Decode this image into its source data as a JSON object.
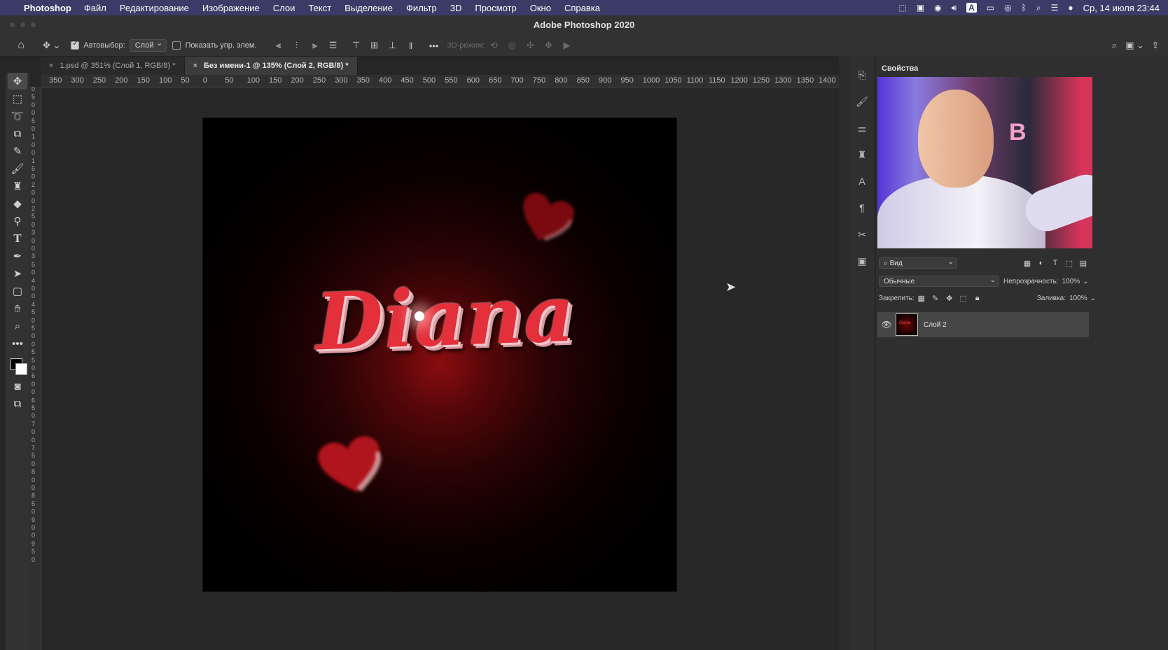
{
  "menubar": {
    "app_name": "Photoshop",
    "items": [
      "Файл",
      "Редактирование",
      "Изображение",
      "Слои",
      "Текст",
      "Выделение",
      "Фильтр",
      "3D",
      "Просмотр",
      "Окно",
      "Справка"
    ],
    "clock": "Ср, 14 июля  23:44",
    "status_icons": [
      "screenshot-icon",
      "record-icon",
      "wifi-icon",
      "volume-icon",
      "keyboard-layout-icon",
      "battery-icon",
      "user-icon",
      "bluetooth-icon",
      "spotlight-icon",
      "control-center-icon",
      "siri-icon"
    ],
    "input_source": "A"
  },
  "window": {
    "title": "Adobe Photoshop 2020"
  },
  "options_bar": {
    "autoselect_label": "Автовыбор:",
    "autoselect_value": "Слой",
    "show_transform_label": "Показать упр. элем.",
    "mode_3d_label": "3D-режим:"
  },
  "tabs": [
    {
      "label": "1.psd @ 351% (Слой 1, RGB/8) *",
      "active": false
    },
    {
      "label": "Без имени-1 @ 135% (Слой 2, RGB/8) *",
      "active": true
    }
  ],
  "ruler_h": [
    "350",
    "300",
    "250",
    "200",
    "150",
    "100",
    "50",
    "0",
    "50",
    "100",
    "150",
    "200",
    "250",
    "300",
    "350",
    "400",
    "450",
    "500",
    "550",
    "600",
    "650",
    "700",
    "750",
    "800",
    "850",
    "900",
    "950",
    "1000",
    "1050",
    "1100",
    "1150",
    "1200",
    "1250",
    "1300",
    "1350",
    "1400"
  ],
  "ruler_v": [
    "0",
    "5",
    "0",
    "0",
    "5",
    "0",
    "1",
    "0",
    "0",
    "1",
    "5",
    "0",
    "2",
    "0",
    "0",
    "2",
    "5",
    "0",
    "3",
    "0",
    "0",
    "3",
    "5",
    "0",
    "4",
    "0",
    "0",
    "4",
    "5",
    "0",
    "5",
    "0",
    "0",
    "5",
    "5",
    "0",
    "6",
    "0",
    "0",
    "6",
    "5",
    "0",
    "7",
    "0",
    "0",
    "7",
    "5",
    "0",
    "8",
    "0",
    "0",
    "8",
    "5",
    "0",
    "9",
    "0",
    "0",
    "9",
    "5",
    "0"
  ],
  "canvas": {
    "text": "Diana",
    "background": "#000000",
    "text_color": "#e3303b"
  },
  "properties_panel": {
    "title": "Свойства",
    "filter_placeholder": "Вид",
    "blend_mode": "Обычные",
    "opacity_label": "Непрозрачность:",
    "opacity_value": "100%",
    "lock_label": "Закрепить:",
    "fill_label": "Заливка:",
    "fill_value": "100%",
    "layers": [
      {
        "name": "Слой 2",
        "visible": true
      }
    ]
  },
  "colors": {
    "menubar": "#3a3b66",
    "panel": "#2f2f2f",
    "accent": "#e3303b"
  }
}
